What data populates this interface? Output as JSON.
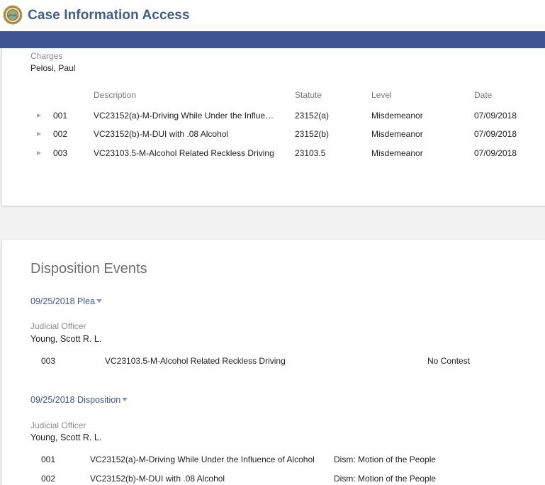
{
  "header": {
    "title": "Case Information Access"
  },
  "charges": {
    "label": "Charges",
    "defendant": "Pelosi, Paul",
    "columns": {
      "description": "Description",
      "statute": "Statute",
      "level": "Level",
      "date": "Date"
    },
    "rows": [
      {
        "num": "001",
        "description": "VC23152(a)-M-Driving While Under the Influe…",
        "statute": "23152(a)",
        "level": "Misdemeanor",
        "date": "07/09/2018"
      },
      {
        "num": "002",
        "description": "VC23152(b)-M-DUI with .08 Alcohol",
        "statute": "23152(b)",
        "level": "Misdemeanor",
        "date": "07/09/2018"
      },
      {
        "num": "003",
        "description": "VC23103.5-M-Alcohol Related Reckless Driving",
        "statute": "23103.5",
        "level": "Misdemeanor",
        "date": "07/09/2018"
      }
    ]
  },
  "disposition": {
    "title": "Disposition Events",
    "events": [
      {
        "link": "09/25/2018 Plea",
        "officer_label": "Judicial Officer",
        "officer": "Young, Scott R. L.",
        "rows": [
          {
            "num": "003",
            "description": "VC23103.5-M-Alcohol Related Reckless Driving",
            "result": "No Contest"
          }
        ]
      },
      {
        "link": "09/25/2018 Disposition",
        "officer_label": "Judicial Officer",
        "officer": "Young, Scott R. L.",
        "rows": [
          {
            "num": "001",
            "description": "VC23152(a)-M-Driving While Under the Influence of Alcohol",
            "result": "Dism: Motion of the People"
          },
          {
            "num": "002",
            "description": "VC23152(b)-M-DUI with .08 Alcohol",
            "result": "Dism: Motion of the People"
          }
        ]
      }
    ]
  }
}
